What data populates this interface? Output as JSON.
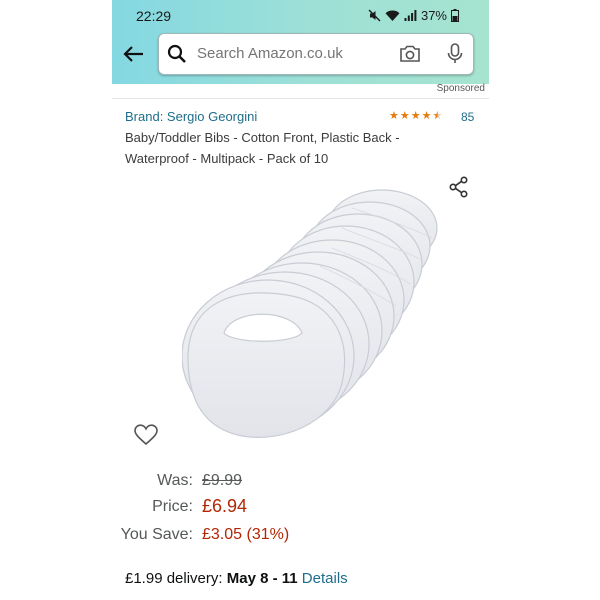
{
  "status_bar": {
    "time": "22:29",
    "battery": "37%"
  },
  "search": {
    "placeholder": "Search Amazon.co.uk"
  },
  "sponsored_label": "Sponsored",
  "product": {
    "brand": "Brand: Sergio Georgini",
    "rating_stars": 4.5,
    "rating_count": "85",
    "title": "Baby/Toddler Bibs - Cotton Front, Plastic Back - Waterproof - Multipack - Pack of 10"
  },
  "pricing": {
    "was_label": "Was:",
    "was_value": "£9.99",
    "price_label": "Price:",
    "price_value": "£6.94",
    "save_label": "You Save:",
    "save_value": "£3.05 (31%)"
  },
  "delivery": {
    "cost": "£1.99 delivery:",
    "dates": "May 8 - 11",
    "details_link": "Details"
  },
  "colors": {
    "header_gradient_start": "#84d8e2",
    "header_gradient_end": "#a6e4cf",
    "link": "#1f6d8a",
    "price_red": "#b12704",
    "star_orange": "#e37b0c"
  },
  "icons": [
    "back-arrow-icon",
    "search-icon",
    "camera-icon",
    "mic-icon",
    "share-icon",
    "heart-icon",
    "mute-icon",
    "wifi-icon",
    "signal-icon",
    "battery-icon"
  ]
}
